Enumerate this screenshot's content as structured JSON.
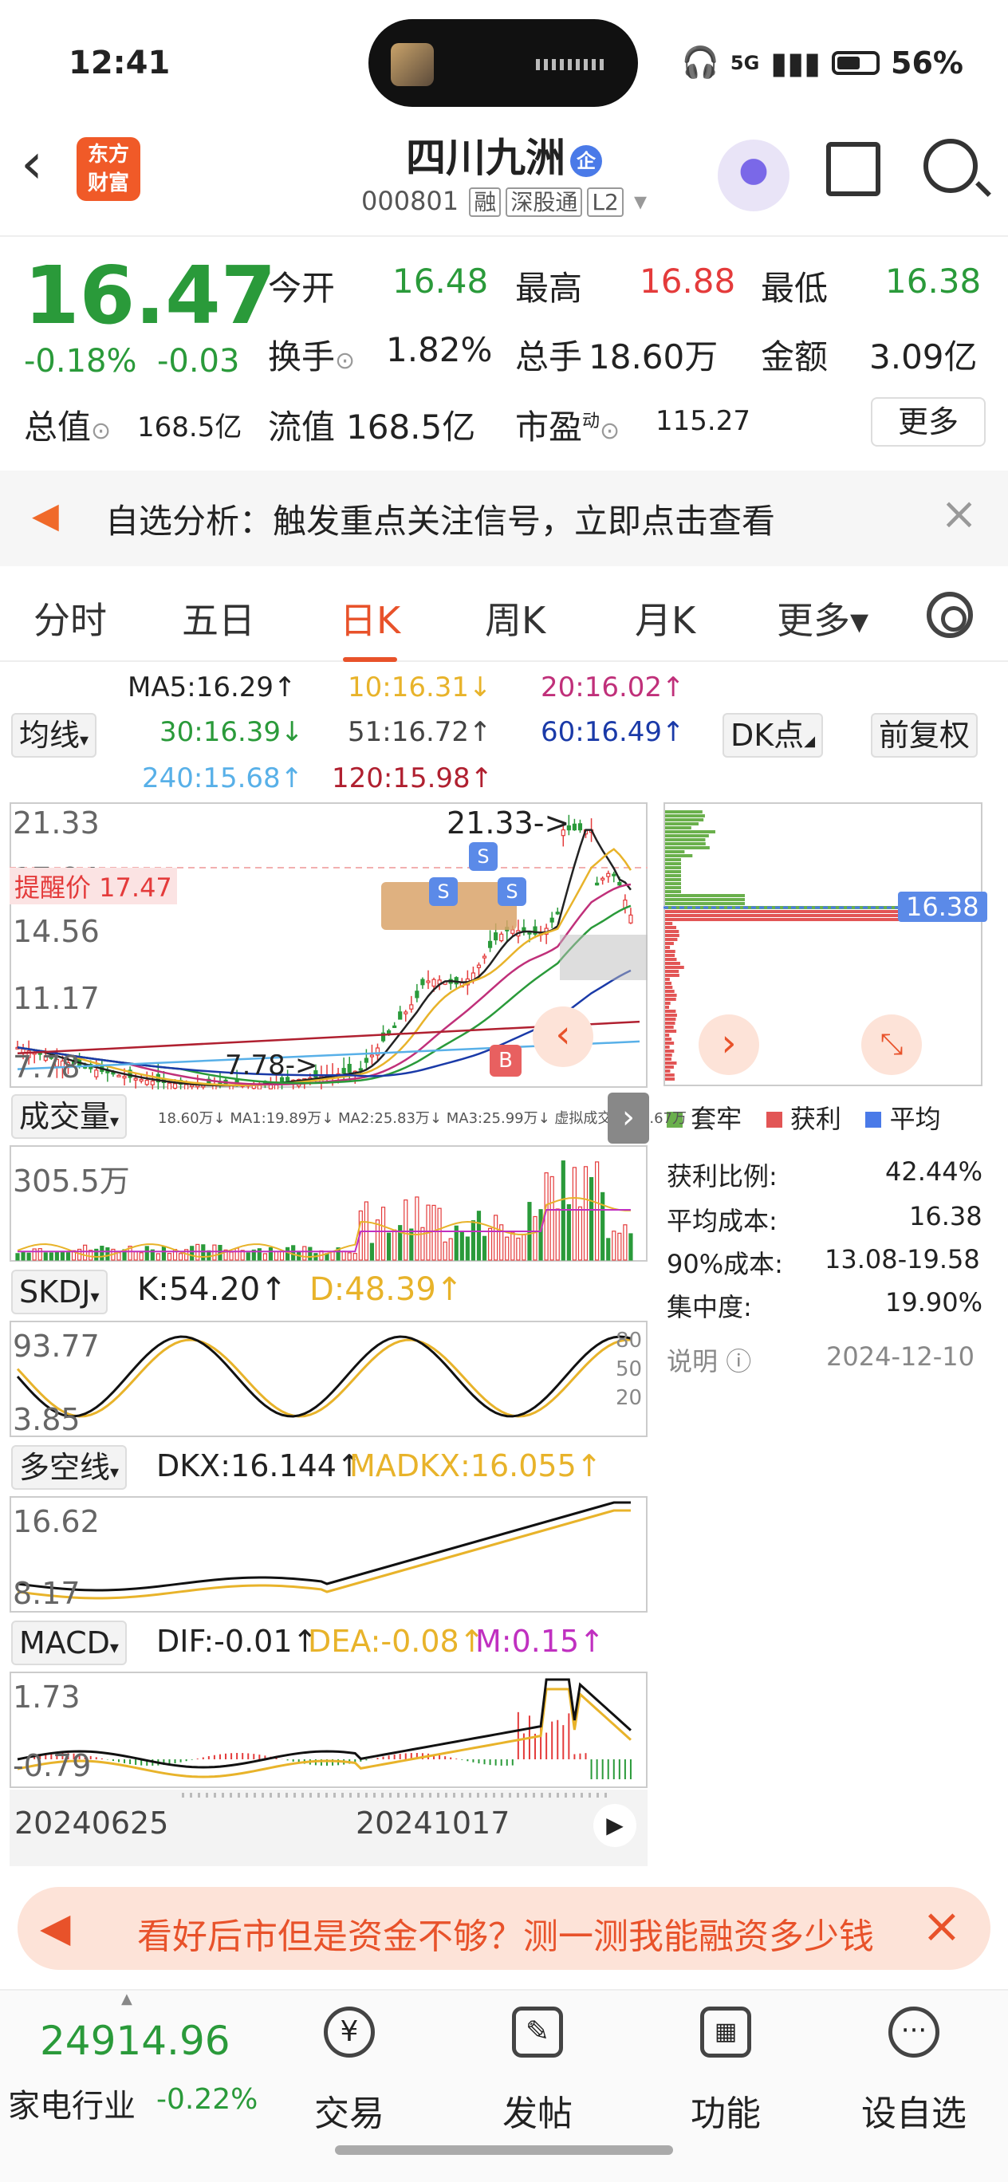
{
  "status_bar": {
    "time": "12:41",
    "signal": "5G",
    "battery": "56%"
  },
  "header": {
    "logo": "东方\n财富",
    "stock_name": "四川九洲",
    "enterprise_badge": "企",
    "code": "000801",
    "tags": [
      "融",
      "深股通",
      "L2"
    ]
  },
  "quote": {
    "price": "16.47",
    "change_pct": "-0.18%",
    "change": "-0.03",
    "open_label": "今开",
    "open": "16.48",
    "high_label": "最高",
    "high": "16.88",
    "low_label": "最低",
    "low": "16.38",
    "turnover_label": "换手",
    "turnover": "1.82%",
    "volume_label": "总手",
    "volume": "18.60万",
    "amount_label": "金额",
    "amount": "3.09亿",
    "mktcap_label": "总值",
    "mktcap": "168.5亿",
    "float_label": "流值",
    "float": "168.5亿",
    "pe_label": "市盈",
    "pe_sup": "动",
    "pe": "115.27",
    "more": "更多"
  },
  "alert": {
    "text": "自选分析：触发重点关注信号，立即点击查看"
  },
  "tabs": [
    {
      "label": "分时"
    },
    {
      "label": "五日"
    },
    {
      "label": "日K"
    },
    {
      "label": "周K"
    },
    {
      "label": "月K"
    },
    {
      "label": "更多▾"
    }
  ],
  "ma_legend": {
    "selector": "均线",
    "ma5": "MA5:16.29↑",
    "ma10": "10:16.31↓",
    "ma20": "20:16.02↑",
    "ma30": "30:16.39↓",
    "ma51": "51:16.72↑",
    "ma60": "60:16.49↑",
    "ma240": "240:15.68↑",
    "ma120": "120:15.98↑",
    "dk": "DK点",
    "adjust": "前复权"
  },
  "kline": {
    "y_labels": [
      "21.33",
      "17.94",
      "14.56",
      "11.17",
      "7.78"
    ],
    "high_annot": "21.33->",
    "low_annot": "7.78->",
    "alert_price": "提醒价 17.47",
    "colors": {
      "up": "#e43b3b",
      "down": "#2a9a3a"
    }
  },
  "chip_dist": {
    "price_tag": "16.38",
    "legend": [
      "套牢",
      "获利",
      "平均"
    ],
    "profit_ratio_label": "获利比例:",
    "profit_ratio": "42.44%",
    "avg_cost_label": "平均成本:",
    "avg_cost": "16.38",
    "cost90_label": "90%成本:",
    "cost90": "13.08-19.58",
    "concentration_label": "集中度:",
    "concentration": "19.90%",
    "note_label": "说明",
    "date": "2024-12-10"
  },
  "volume": {
    "selector": "成交量",
    "legend": "18.60万↓ MA1:19.89万↓ MA2:25.83万↓ MA3:25.99万↓ 虚拟成交量:31.67万",
    "y_max": "305.5万"
  },
  "skdj": {
    "selector": "SKDJ",
    "k": "K:54.20↑",
    "d": "D:48.39↑",
    "y_max": "93.77",
    "y_min": "3.85",
    "levels": [
      "80",
      "50",
      "20"
    ]
  },
  "dkx": {
    "selector": "多空线",
    "dkx": "DKX:16.144↑",
    "madkx": "MADKX:16.055↑",
    "y_max": "16.62",
    "y_min": "8.17"
  },
  "macd": {
    "selector": "MACD",
    "dif": "DIF:-0.01↑",
    "dea": "DEA:-0.08↑",
    "m": "M:0.15↑",
    "y_max": "1.73",
    "y_min": "-0.79"
  },
  "dates": [
    "20240625",
    "20241017"
  ],
  "ad": {
    "text": "看好后市但是资金不够？测一测我能融资多少钱"
  },
  "bottom_nav": {
    "index_value": "24914.96",
    "index_name": "家电行业",
    "index_chg": "-0.22%",
    "items": [
      {
        "label": "交易"
      },
      {
        "label": "发帖"
      },
      {
        "label": "功能"
      },
      {
        "label": "设自选"
      }
    ]
  }
}
